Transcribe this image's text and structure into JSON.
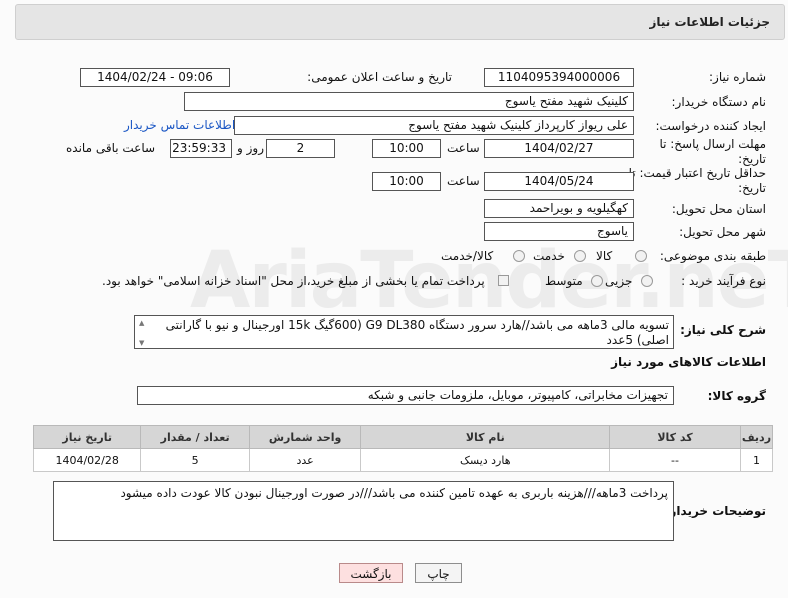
{
  "panel_title": "جزئیات اطلاعات نیاز",
  "fields": {
    "need_number_label": "شماره نیاز:",
    "need_number": "1104095394000006",
    "announce_label": "تاریخ و ساعت اعلان عمومی:",
    "announce_value": "1404/02/24 - 09:06",
    "buyer_org_label": "نام دستگاه خریدار:",
    "buyer_org": "کلینیک شهید مفتح یاسوج",
    "requester_label": "ایجاد کننده درخواست:",
    "requester": "علی ریواز کارپرداز کلینیک شهید مفتح یاسوج",
    "contact_link": "اطلاعات تماس خریدار",
    "reply_deadline_label": "مهلت ارسال پاسخ: تا تاریخ:",
    "reply_date": "1404/02/27",
    "time_label": "ساعت",
    "reply_time": "10:00",
    "days_value": "2",
    "days_label": "روز و",
    "remaining_time": "23:59:33",
    "remaining_label": "ساعت باقی مانده",
    "price_deadline_label": "حداقل تاریخ اعتبار قیمت: تا تاریخ:",
    "price_date": "1404/05/24",
    "price_time": "10:00",
    "province_label": "استان محل تحویل:",
    "province": "کهگیلویه و بویراحمد",
    "city_label": "شهر محل تحویل:",
    "city": "یاسوج",
    "category_label": "طبقه بندی موضوعی:",
    "category_options": [
      "کالا",
      "خدمت",
      "کالا/خدمت"
    ],
    "process_label": "نوع فرآیند خرید :",
    "process_options": [
      "جزیی",
      "متوسط"
    ],
    "payment_text": "پرداخت تمام یا بخشی از مبلغ خرید،از محل \"اسناد خزانه اسلامی\" خواهد بود."
  },
  "description": {
    "label": "شرح کلی نیاز:",
    "text": "تسویه مالی 3ماهه می باشد//هارد سرور دستگاه G9 DL380  (600گیگ 15k اورجینال و نیو با گارانتی اصلی)   5عدد"
  },
  "goods_section_title": "اطلاعات کالاهای مورد نیاز",
  "goods_group": {
    "label": "گروه کالا:",
    "value": "تجهیزات مخابراتی، کامپیوتر، موبایل، ملزومات جانبی و شبکه"
  },
  "table": {
    "headers": [
      "ردیف",
      "کد کالا",
      "نام کالا",
      "واحد شمارش",
      "تعداد / مقدار",
      "تاریخ نیاز"
    ],
    "rows": [
      [
        "1",
        "--",
        "هارد دیسک",
        "عدد",
        "5",
        "1404/02/28"
      ]
    ]
  },
  "buyer_notes": {
    "label": "توضیحات خریدار:",
    "text": "پرداخت 3ماهه///هزینه باربری به عهده تامین کننده می باشد///در صورت اورجینال نبودن کالا عودت داده میشود"
  },
  "buttons": {
    "print": "چاپ",
    "back": "بازگشت"
  },
  "watermark": "AriaTender.neT"
}
